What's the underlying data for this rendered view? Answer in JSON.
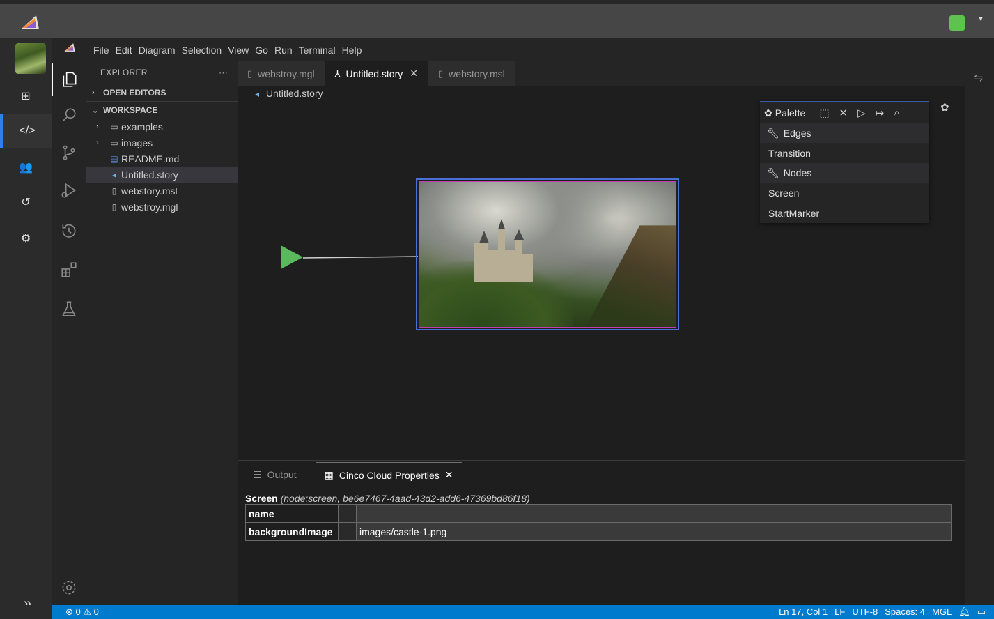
{
  "menu": [
    "File",
    "Edit",
    "Diagram",
    "Selection",
    "View",
    "Go",
    "Run",
    "Terminal",
    "Help"
  ],
  "explorer": {
    "title": "EXPLORER",
    "more": "···",
    "open_editors": "OPEN EDITORS",
    "workspace": "WORKSPACE",
    "items": [
      {
        "label": "examples",
        "kind": "folder"
      },
      {
        "label": "images",
        "kind": "folder"
      },
      {
        "label": "README.md",
        "kind": "markdown"
      },
      {
        "label": "Untitled.story",
        "kind": "story",
        "selected": true
      },
      {
        "label": "webstory.msl",
        "kind": "file"
      },
      {
        "label": "webstroy.mgl",
        "kind": "file"
      }
    ]
  },
  "tabs": [
    {
      "label": "webstroy.mgl",
      "active": false
    },
    {
      "label": "Untitled.story",
      "active": true
    },
    {
      "label": "webstory.msl",
      "active": false
    }
  ],
  "breadcrumb": "Untitled.story",
  "palette": {
    "title": "Palette",
    "groups": [
      {
        "label": "Edges",
        "items": [
          "Transition"
        ]
      },
      {
        "label": "Nodes",
        "items": [
          "Screen",
          "StartMarker"
        ]
      }
    ]
  },
  "panel": {
    "tabs": [
      "Output",
      "Cinco Cloud Properties"
    ],
    "title_bold": "Screen",
    "title_italic": "(node:screen, be6e7467-4aad-43d2-add6-47369bd86f18)",
    "rows": [
      {
        "key": "name",
        "value": ""
      },
      {
        "key": "backgroundImage",
        "value": "images/castle-1.png"
      }
    ]
  },
  "status": {
    "left": "⊗ 0 ⚠ 0",
    "right": [
      "Ln 17, Col 1",
      "LF",
      "UTF-8",
      "Spaces: 4",
      "MGL"
    ]
  },
  "colors": {
    "accent": "#007acc",
    "start_marker": "#5cb85c",
    "selection_border": "#4a6fd6"
  }
}
